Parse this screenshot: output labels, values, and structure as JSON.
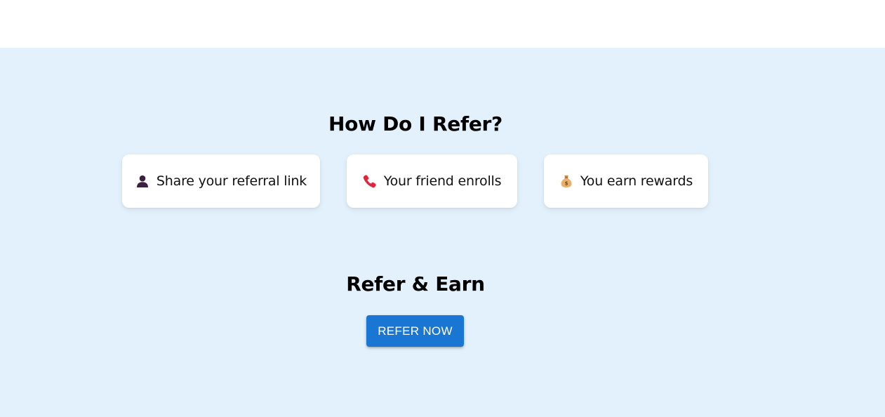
{
  "how_section": {
    "title": "How Do I Refer?",
    "steps": [
      {
        "icon": "person-icon",
        "label": "Share your referral link"
      },
      {
        "icon": "phone-icon",
        "label": "Your friend enrolls"
      },
      {
        "icon": "money-bag-icon",
        "label": "You earn rewards"
      }
    ]
  },
  "refer_section": {
    "title": "Refer & Earn",
    "button_label": "REFER NOW"
  },
  "colors": {
    "section_background": "#e3f1fc",
    "button_primary": "#1976d2",
    "card_background": "#ffffff"
  }
}
